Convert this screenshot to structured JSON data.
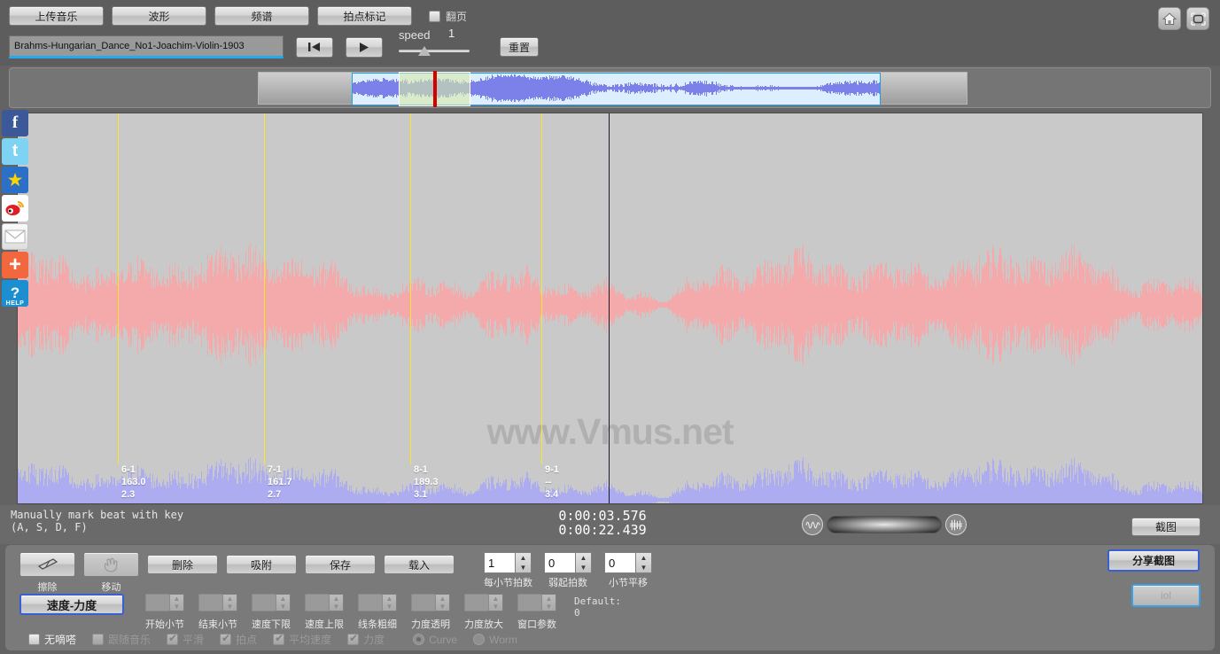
{
  "top": {
    "buttons": [
      {
        "name": "upload-music",
        "label": "上传音乐"
      },
      {
        "name": "waveform",
        "label": "波形"
      },
      {
        "name": "spectrum",
        "label": "频谱"
      },
      {
        "name": "beat-mark",
        "label": "拍点标记"
      }
    ],
    "page_turn": {
      "label": "翻页",
      "checked": false
    },
    "song_name": "Brahms-Hungarian_Dance_No1-Joachim-Violin-1903",
    "prev_icon": "skip-to-start-icon",
    "play_icon": "play-icon",
    "speed_label": "speed",
    "speed_value": "1",
    "reset_label": "重置",
    "home_icon": "home-icon",
    "fullscreen_icon": "fullscreen-icon"
  },
  "social": [
    {
      "name": "facebook",
      "glyph": "f"
    },
    {
      "name": "twitter",
      "glyph": "t"
    },
    {
      "name": "qzone",
      "glyph": "★"
    },
    {
      "name": "weibo",
      "glyph": "◉"
    },
    {
      "name": "email",
      "glyph": "✉"
    },
    {
      "name": "share-more",
      "glyph": "+"
    },
    {
      "name": "help",
      "glyph": "?",
      "caption": "HELP"
    }
  ],
  "wave": {
    "watermark": "www.Vmus.net",
    "beats": [
      {
        "bar": "6-1",
        "tempo": "163.0",
        "time": "2.3"
      },
      {
        "bar": "7-1",
        "tempo": "161.7",
        "time": "2.7"
      },
      {
        "bar": "8-1",
        "tempo": "189.3",
        "time": "3.1"
      },
      {
        "bar": "9-1",
        "tempo": "--",
        "time": "3.4"
      }
    ]
  },
  "info": {
    "hint_line1": "Manually mark beat with key",
    "hint_line2": "(A, S, D, F)",
    "time_current": "0:00:03.576",
    "time_total": "0:00:22.439",
    "zoom_out_icon": "waveform-wide-icon",
    "zoom_in_icon": "waveform-dense-icon",
    "screenshot_label": "截图"
  },
  "bottom": {
    "tools": [
      {
        "name": "erase",
        "label": "擦除",
        "icon": "eraser-icon"
      },
      {
        "name": "move",
        "label": "移动",
        "icon": "hand-move-icon"
      }
    ],
    "actions": [
      {
        "name": "delete",
        "label": "删除"
      },
      {
        "name": "snap",
        "label": "吸附"
      },
      {
        "name": "save",
        "label": "保存"
      },
      {
        "name": "load",
        "label": "载入"
      }
    ],
    "spinners_row1": [
      {
        "name": "beats-per-bar",
        "label": "每小节拍数",
        "value": "1",
        "enabled": true
      },
      {
        "name": "pickup-beats",
        "label": "弱起拍数",
        "value": "0",
        "enabled": true
      },
      {
        "name": "bar-shift",
        "label": "小节平移",
        "value": "0",
        "enabled": true
      }
    ],
    "tempo_dynamics_label": "速度-力度",
    "spinners_row2": [
      {
        "name": "start-bar",
        "label": "开始小节",
        "value": "",
        "enabled": false
      },
      {
        "name": "end-bar",
        "label": "结束小节",
        "value": "",
        "enabled": false
      },
      {
        "name": "tempo-min",
        "label": "速度下限",
        "value": "",
        "enabled": false
      },
      {
        "name": "tempo-max",
        "label": "速度上限",
        "value": "",
        "enabled": false
      },
      {
        "name": "line-thickness",
        "label": "线条粗细",
        "value": "",
        "enabled": false
      },
      {
        "name": "dynamics-opacity",
        "label": "力度透明",
        "value": "",
        "enabled": false
      },
      {
        "name": "dynamics-scale",
        "label": "力度放大",
        "value": "",
        "enabled": false
      },
      {
        "name": "window-param",
        "label": "窗口参数",
        "value": "",
        "enabled": false
      }
    ],
    "default_note_line1": "Default:",
    "default_note_line2": "0",
    "checks": [
      {
        "name": "no-tick",
        "label": "无嘀嗒",
        "checked": false,
        "enabled": true
      },
      {
        "name": "follow-music",
        "label": "跟随音乐",
        "checked": false,
        "enabled": false
      },
      {
        "name": "smooth",
        "label": "平滑",
        "checked": true,
        "enabled": false
      },
      {
        "name": "beat-point",
        "label": "拍点",
        "checked": true,
        "enabled": false
      },
      {
        "name": "average-tempo",
        "label": "平均速度",
        "checked": true,
        "enabled": false
      },
      {
        "name": "dynamics",
        "label": "力度",
        "checked": true,
        "enabled": false
      }
    ],
    "radios": [
      {
        "name": "curve",
        "label": "Curve",
        "selected": true
      },
      {
        "name": "worm",
        "label": "Worm",
        "selected": false
      }
    ],
    "share_label": "分享截图",
    "iol_label": "iol"
  },
  "colors": {
    "accent_blue": "#22aaf0",
    "focus_blue": "#3a5fd4",
    "wave_top": "#f4a9ab",
    "wave_bottom": "#adacf0",
    "beat_marker": "#fbe623",
    "cursor_red": "#d40000",
    "panel_gray": "#7a7a7a"
  }
}
